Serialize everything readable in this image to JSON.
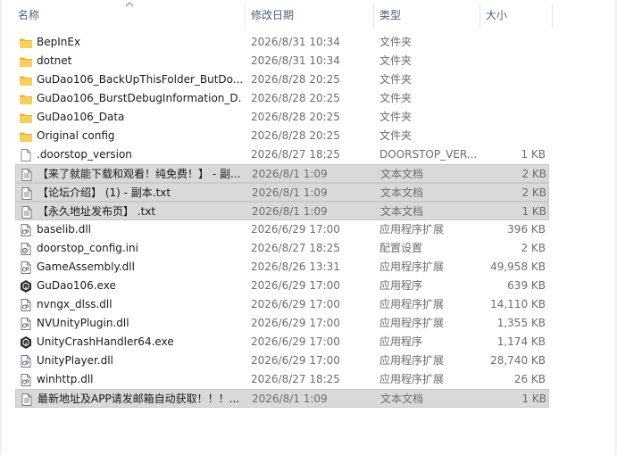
{
  "columns": {
    "name": "名称",
    "date": "修改日期",
    "type": "类型",
    "size": "大小"
  },
  "colors": {
    "header_text": "#4c607a",
    "selected_bg": "#d9d9d9",
    "folder": "#f2c14e"
  },
  "files": [
    {
      "name": "BepInEx",
      "date": "2026/8/31 10:34",
      "type": "文件夹",
      "size": "",
      "icon": "folder-icon",
      "selected": false
    },
    {
      "name": "dotnet",
      "date": "2026/8/31 10:34",
      "type": "文件夹",
      "size": "",
      "icon": "folder-icon",
      "selected": false
    },
    {
      "name": "GuDao106_BackUpThisFolder_ButDo...",
      "date": "2026/8/28 20:25",
      "type": "文件夹",
      "size": "",
      "icon": "folder-icon",
      "selected": false
    },
    {
      "name": "GuDao106_BurstDebugInformation_D...",
      "date": "2026/8/28 20:25",
      "type": "文件夹",
      "size": "",
      "icon": "folder-icon",
      "selected": false
    },
    {
      "name": "GuDao106_Data",
      "date": "2026/8/28 20:25",
      "type": "文件夹",
      "size": "",
      "icon": "folder-icon",
      "selected": false
    },
    {
      "name": "Original config",
      "date": "2026/8/28 20:25",
      "type": "文件夹",
      "size": "",
      "icon": "folder-icon",
      "selected": false
    },
    {
      "name": ".doorstop_version",
      "date": "2026/8/27 18:25",
      "type": "DOORSTOP_VER...",
      "size": "1 KB",
      "icon": "blank-file-icon",
      "selected": false
    },
    {
      "name": "【来了就能下载和观看！纯免费！】 - 副...",
      "date": "2026/8/1 1:09",
      "type": "文本文档",
      "size": "2 KB",
      "icon": "text-file-icon",
      "selected": true
    },
    {
      "name": "【论坛介绍】 (1) - 副本.txt",
      "date": "2026/8/1 1:09",
      "type": "文本文档",
      "size": "2 KB",
      "icon": "text-file-icon",
      "selected": true
    },
    {
      "name": "【永久地址发布页】 .txt",
      "date": "2026/8/1 1:09",
      "type": "文本文档",
      "size": "1 KB",
      "icon": "text-file-icon",
      "selected": true
    },
    {
      "name": "baselib.dll",
      "date": "2026/6/29 17:00",
      "type": "应用程序扩展",
      "size": "396 KB",
      "icon": "dll-file-icon",
      "selected": false
    },
    {
      "name": "doorstop_config.ini",
      "date": "2026/8/27 18:25",
      "type": "配置设置",
      "size": "2 KB",
      "icon": "config-file-icon",
      "selected": false
    },
    {
      "name": "GameAssembly.dll",
      "date": "2026/8/26 13:31",
      "type": "应用程序扩展",
      "size": "49,958 KB",
      "icon": "dll-file-icon",
      "selected": false
    },
    {
      "name": "GuDao106.exe",
      "date": "2026/6/29 17:00",
      "type": "应用程序",
      "size": "639 KB",
      "icon": "unity-exe-icon",
      "selected": false
    },
    {
      "name": "nvngx_dlss.dll",
      "date": "2026/6/29 17:00",
      "type": "应用程序扩展",
      "size": "14,110 KB",
      "icon": "dll-file-icon",
      "selected": false
    },
    {
      "name": "NVUnityPlugin.dll",
      "date": "2026/6/29 17:00",
      "type": "应用程序扩展",
      "size": "1,355 KB",
      "icon": "dll-file-icon",
      "selected": false
    },
    {
      "name": "UnityCrashHandler64.exe",
      "date": "2026/6/29 17:00",
      "type": "应用程序",
      "size": "1,174 KB",
      "icon": "unity-exe-icon",
      "selected": false
    },
    {
      "name": "UnityPlayer.dll",
      "date": "2026/6/29 17:00",
      "type": "应用程序扩展",
      "size": "28,740 KB",
      "icon": "dll-file-icon",
      "selected": false
    },
    {
      "name": "winhttp.dll",
      "date": "2026/8/27 18:25",
      "type": "应用程序扩展",
      "size": "26 KB",
      "icon": "dll-file-icon",
      "selected": false
    },
    {
      "name": "最新地址及APP请发邮箱自动获取！！！...",
      "date": "2026/8/1 1:09",
      "type": "文本文档",
      "size": "1 KB",
      "icon": "text-file-icon",
      "selected": true
    }
  ]
}
